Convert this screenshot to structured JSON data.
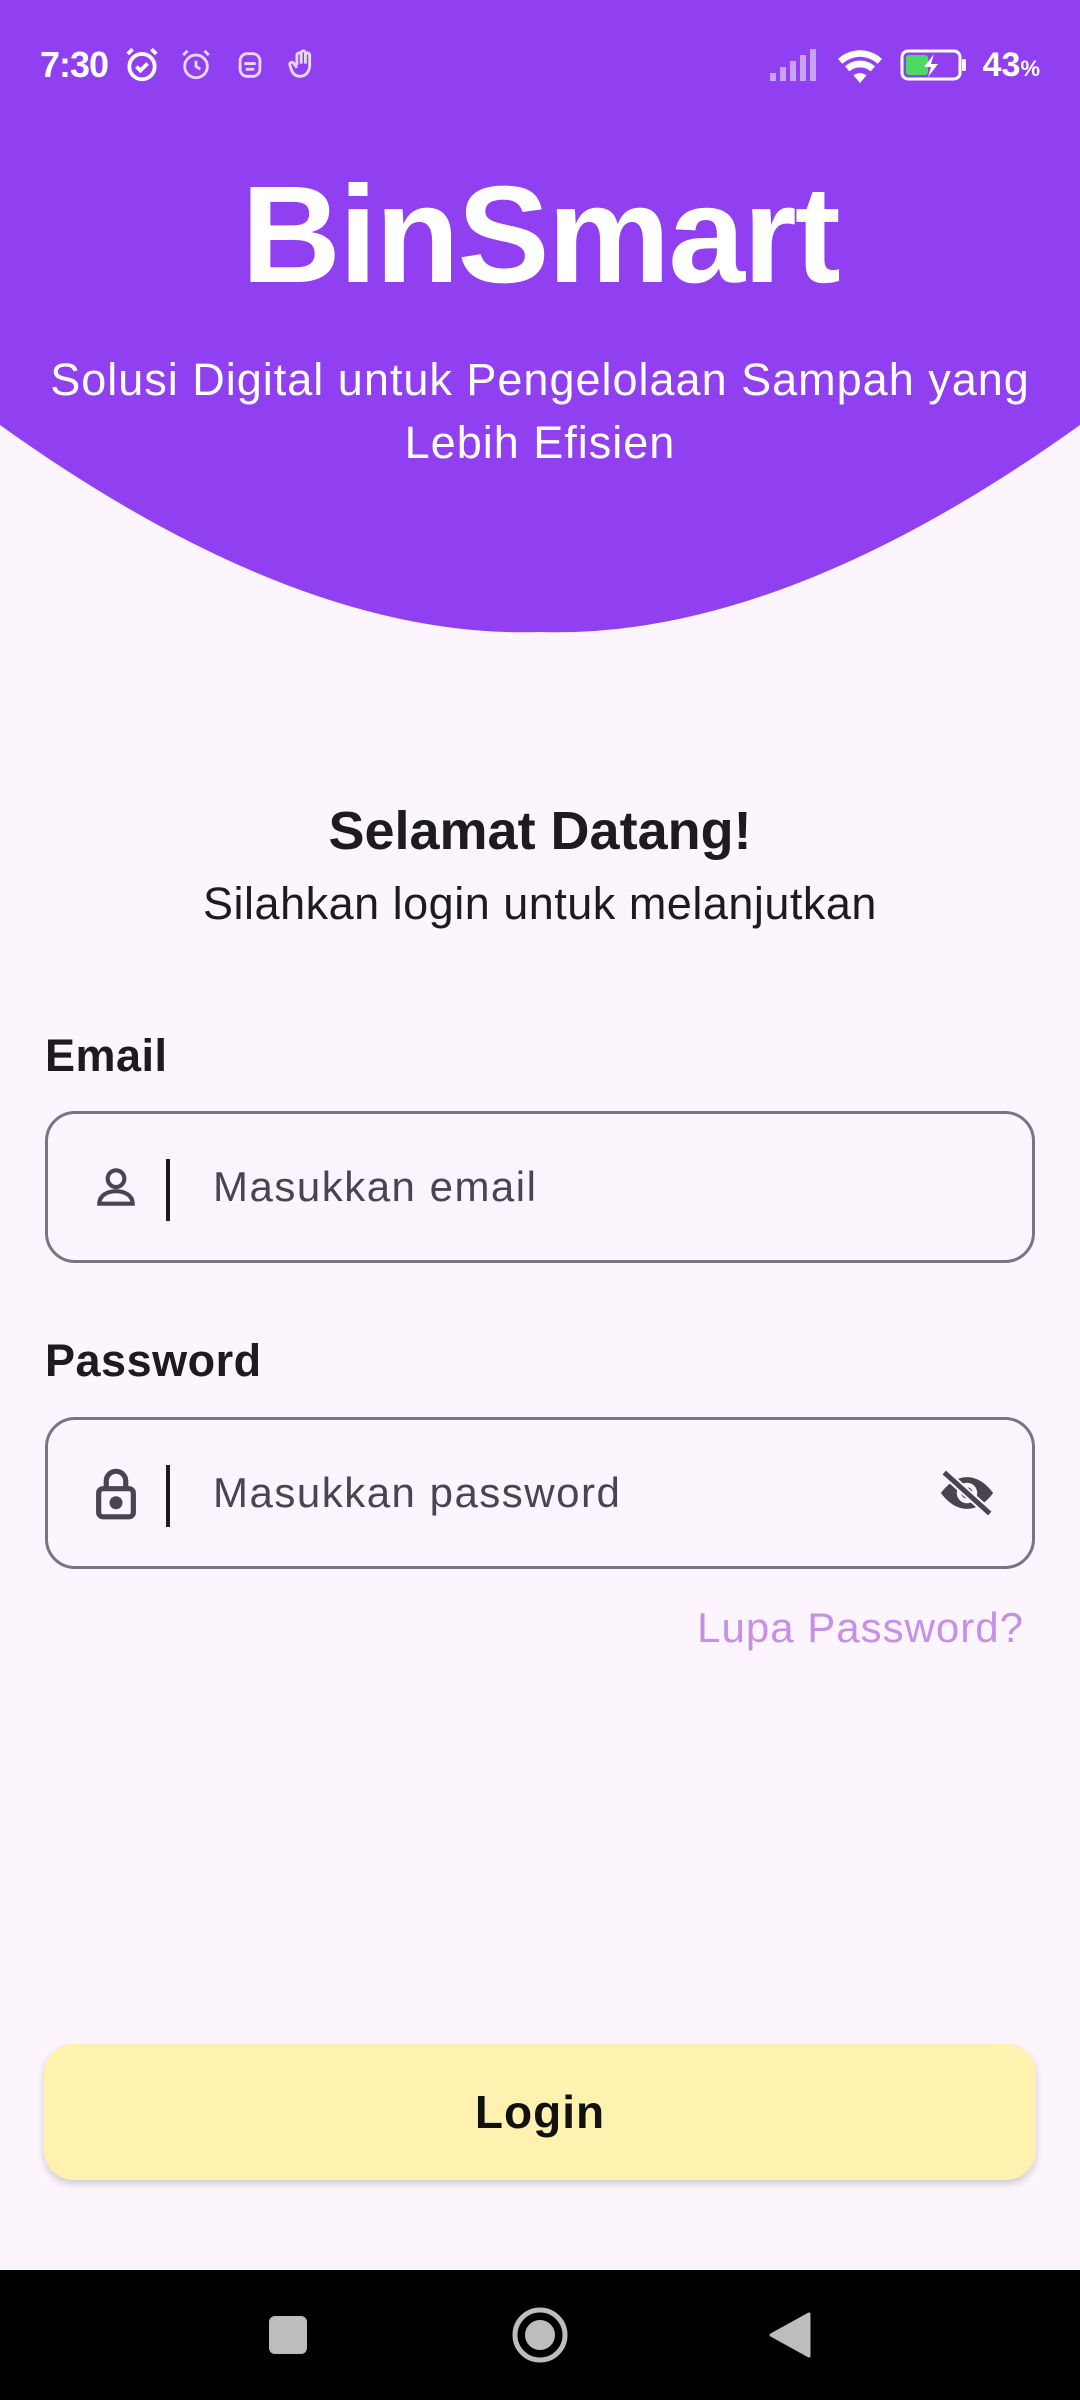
{
  "status_bar": {
    "time": "7:30",
    "battery_percent": "43",
    "battery_unit": "%",
    "icons": [
      "alarm-check-icon",
      "alarm-icon",
      "bot-icon",
      "hand-icon",
      "signal-icon",
      "wifi-icon",
      "battery-charging-icon"
    ]
  },
  "header": {
    "title": "BinSmart",
    "subtitle": "Solusi Digital untuk Pengelolaan Sampah yang Lebih Efisien",
    "background_color": "#9040f0"
  },
  "welcome": {
    "title": "Selamat Datang!",
    "subtitle": "Silahkan login untuk melanjutkan"
  },
  "form": {
    "email": {
      "label": "Email",
      "placeholder": "Masukkan email",
      "value": "",
      "icon": "person-icon"
    },
    "password": {
      "label": "Password",
      "placeholder": "Masukkan password",
      "value": "",
      "icon": "lock-icon",
      "toggle_icon": "eye-off-icon"
    },
    "forgot_password": "Lupa Password?",
    "login_label": "Login",
    "login_color": "#fff2b0",
    "link_color": "#c590e6"
  },
  "nav_bar": {
    "buttons": [
      "recents-square-icon",
      "home-circle-icon",
      "back-triangle-icon"
    ]
  }
}
